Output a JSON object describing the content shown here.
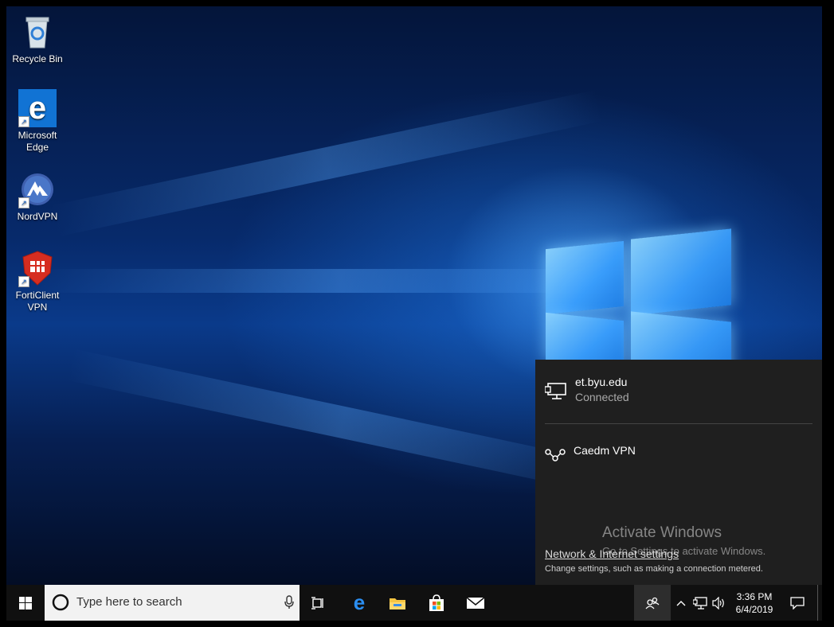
{
  "desktop": {
    "icons": [
      {
        "label": "Recycle Bin",
        "icon": "recycle-bin-icon"
      },
      {
        "label": "Microsoft Edge",
        "icon": "edge-icon"
      },
      {
        "label": "NordVPN",
        "icon": "nordvpn-icon"
      },
      {
        "label": "FortiClient VPN",
        "icon": "forticlient-icon"
      }
    ]
  },
  "network_flyout": {
    "connections": [
      {
        "name": "et.byu.edu",
        "status": "Connected",
        "icon": "ethernet-icon"
      },
      {
        "name": "Caedm VPN",
        "status": "",
        "icon": "vpn-icon"
      }
    ],
    "settings_link": "Network & Internet settings",
    "settings_desc": "Change settings, such as making a connection metered."
  },
  "watermark": {
    "title": "Activate Windows",
    "subtitle": "Go to Settings to activate Windows."
  },
  "taskbar": {
    "search_placeholder": "Type here to search",
    "pinned": [
      "task-view-icon",
      "edge-icon",
      "file-explorer-icon",
      "store-icon",
      "mail-icon"
    ],
    "clock": {
      "time": "3:36 PM",
      "date": "6/4/2019"
    }
  },
  "colors": {
    "flyout_bg": "#1f1f1f",
    "taskbar_bg": "#101010",
    "accent": "#0078d7"
  }
}
